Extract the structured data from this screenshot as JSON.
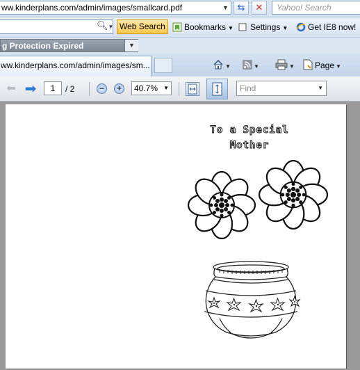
{
  "browser": {
    "address_url": "ww.kinderplans.com/admin/images/smallcard.pdf",
    "search_placeholder": "Yahoo! Search",
    "toolbar": {
      "web_search_label": "Web Search",
      "bookmarks_label": "Bookmarks",
      "settings_label": "Settings",
      "get_ie8_label": "Get IE8 now!"
    },
    "protection_label": "g Protection Expired",
    "tab_title": "ww.kinderplans.com/admin/images/sm...",
    "commands": {
      "page_label": "Page"
    }
  },
  "pdf_toolbar": {
    "current_page": "1",
    "page_total": "/ 2",
    "zoom_level": "40.7%",
    "find_placeholder": "Find"
  },
  "document": {
    "card_title": "To a Special Mother"
  },
  "colors": {
    "ie_blue": "#2b6bc5",
    "stop_red": "#c8292b",
    "web_search_yellow": "#f6c550"
  }
}
